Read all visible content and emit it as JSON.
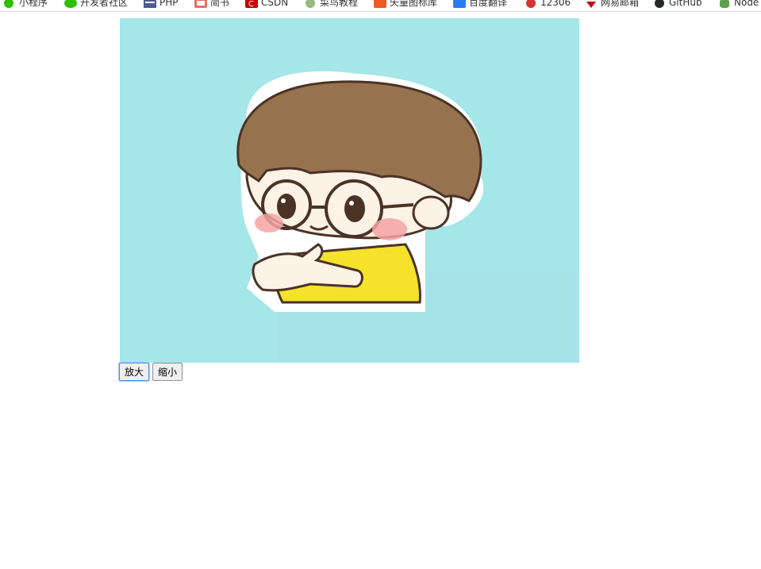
{
  "bookmarks": [
    {
      "label": "小程序",
      "icon": "wechat-miniprogram-icon",
      "color": "#2dc100"
    },
    {
      "label": "开发者社区",
      "icon": "wechat-icon",
      "color": "#2dc100"
    },
    {
      "label": "PHP",
      "icon": "php-icon",
      "color": "#4f5b93"
    },
    {
      "label": "简书",
      "icon": "jianshu-icon",
      "color": "#ea6f5a"
    },
    {
      "label": "CSDN",
      "icon": "csdn-icon",
      "color": "#c90000"
    },
    {
      "label": "菜鸟教程",
      "icon": "runoob-icon",
      "color": "#96b97d"
    },
    {
      "label": "矢量图标库",
      "icon": "iconfont-icon",
      "color": "#f0591f"
    },
    {
      "label": "百度翻译",
      "icon": "baidu-translate-icon",
      "color": "#2a7df0"
    },
    {
      "label": "12306",
      "icon": "railway-icon",
      "color": "#d63333"
    },
    {
      "label": "网易邮箱",
      "icon": "netease-mail-icon",
      "color": "#c4000a"
    },
    {
      "label": "GitHub",
      "icon": "github-icon",
      "color": "#24292e"
    },
    {
      "label": "Node",
      "icon": "nodejs-icon",
      "color": "#5fa04e"
    }
  ],
  "image": {
    "alt": "cartoon boy with glasses",
    "background": "#a5e6e8"
  },
  "controls": {
    "zoom_in_label": "放大",
    "zoom_out_label": "缩小"
  }
}
